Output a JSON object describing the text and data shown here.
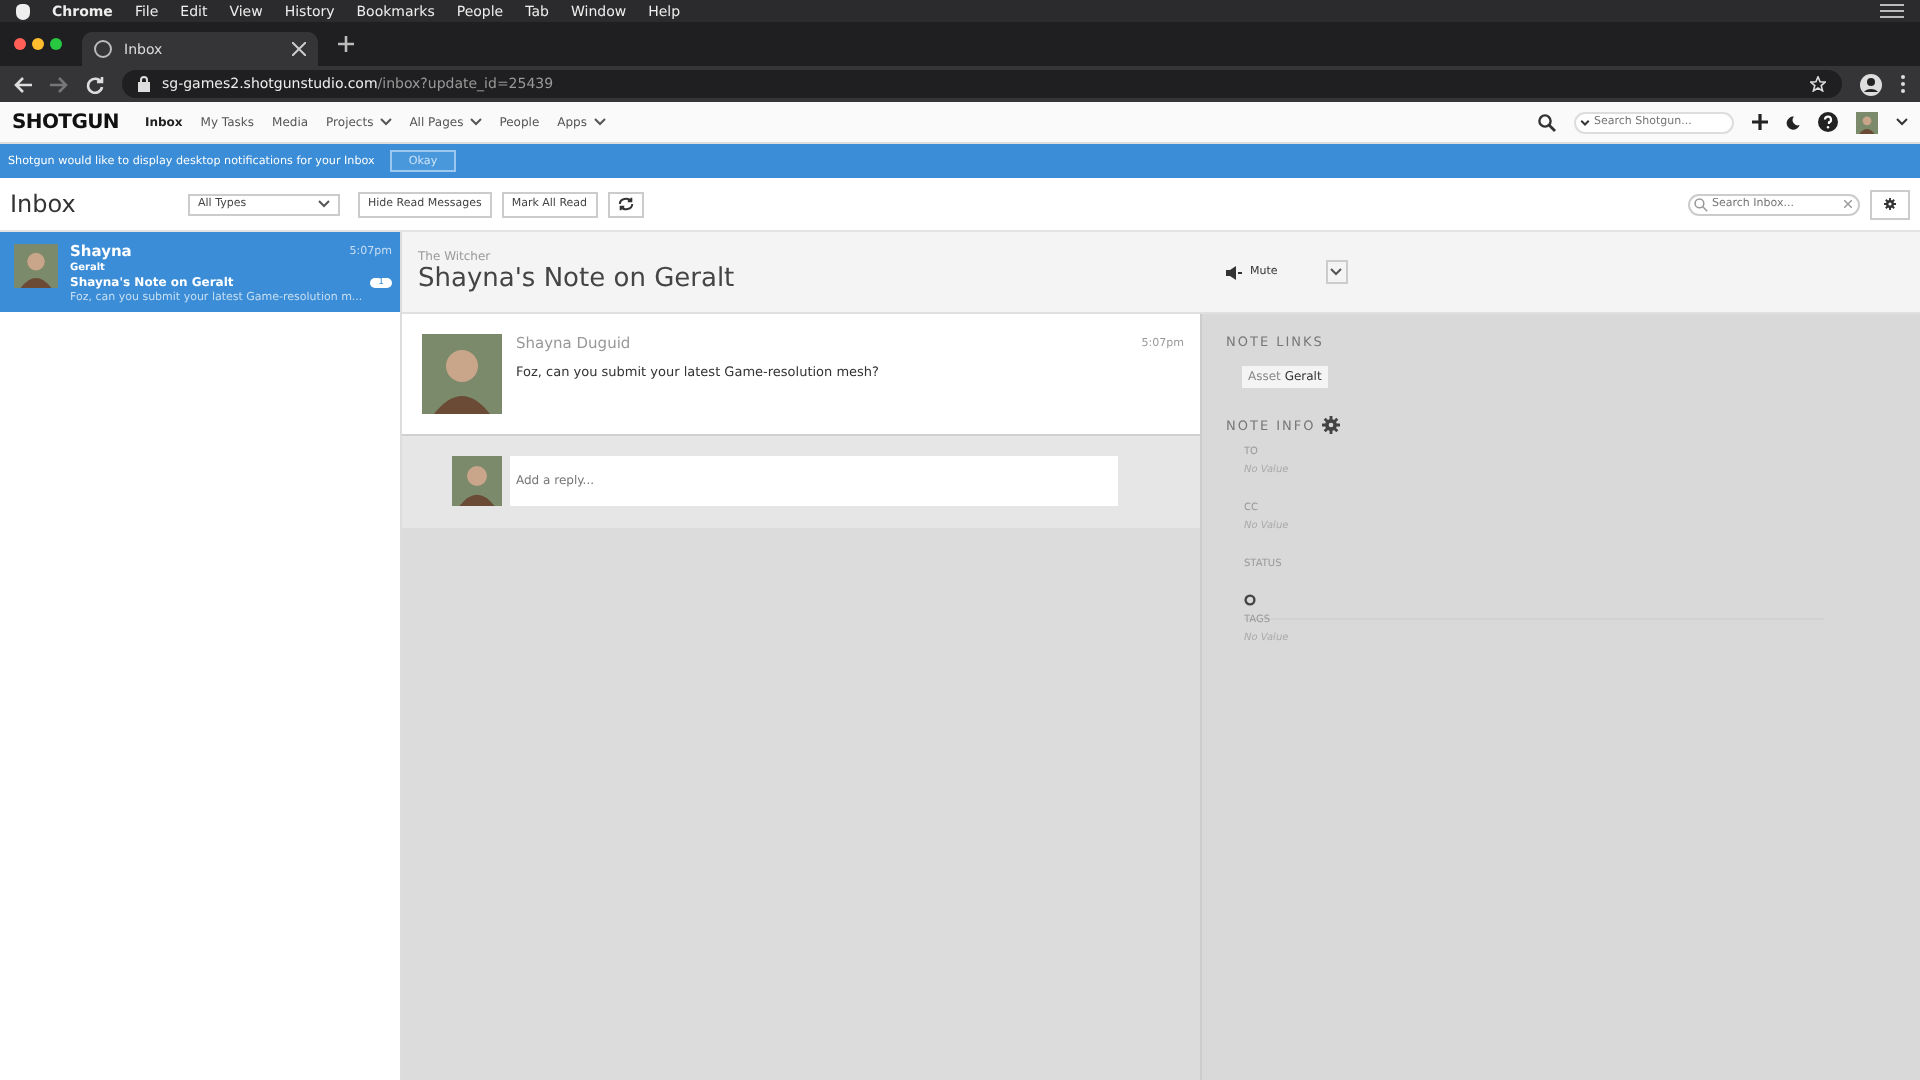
{
  "mac_menu": {
    "app": "Chrome",
    "items": [
      "File",
      "Edit",
      "View",
      "History",
      "Bookmarks",
      "People",
      "Tab",
      "Window",
      "Help"
    ]
  },
  "browser": {
    "tab_title": "Inbox",
    "url_host": "sg-games2.shotgunstudio.com",
    "url_path": "/inbox?update_id=25439"
  },
  "app_nav": {
    "logo": "SHOTGUN",
    "items": [
      {
        "label": "Inbox",
        "selected": true,
        "dropdown": false
      },
      {
        "label": "My Tasks",
        "selected": false,
        "dropdown": false
      },
      {
        "label": "Media",
        "selected": false,
        "dropdown": false
      },
      {
        "label": "Projects",
        "selected": false,
        "dropdown": true
      },
      {
        "label": "All Pages",
        "selected": false,
        "dropdown": true
      },
      {
        "label": "People",
        "selected": false,
        "dropdown": false
      },
      {
        "label": "Apps",
        "selected": false,
        "dropdown": true
      }
    ],
    "search_placeholder": "Search Shotgun..."
  },
  "banner": {
    "message": "Shotgun would like to display desktop notifications for your Inbox",
    "button": "Okay"
  },
  "toolbar": {
    "title": "Inbox",
    "filter": "All Types",
    "buttons": [
      "Hide Read Messages",
      "Mark All Read"
    ],
    "search_placeholder": "Search Inbox..."
  },
  "inbox_items": [
    {
      "sender": "Shayna",
      "entity": "Geralt",
      "subject": "Shayna's Note on Geralt",
      "preview": "Foz, can you submit your latest Game-resolution m...",
      "time": "5:07pm",
      "count": "1",
      "selected": true
    }
  ],
  "note": {
    "project": "The Witcher",
    "title": "Shayna's Note on Geralt",
    "mute": "Mute",
    "author": "Shayna Duguid",
    "time": "5:07pm",
    "body": "Foz, can you submit your latest Game-resolution mesh?",
    "reply_placeholder": "Add a reply..."
  },
  "note_links": {
    "heading": "NOTE LINKS",
    "links": [
      {
        "type": "Asset",
        "name": "Geralt"
      }
    ]
  },
  "note_info": {
    "heading": "NOTE INFO",
    "fields": [
      {
        "label": "TO",
        "kind": "text",
        "value": "No Value"
      },
      {
        "label": "CC",
        "kind": "text",
        "value": "No Value"
      },
      {
        "label": "STATUS",
        "kind": "status"
      },
      {
        "label": "TAGS",
        "kind": "text",
        "value": "No Value"
      }
    ]
  }
}
